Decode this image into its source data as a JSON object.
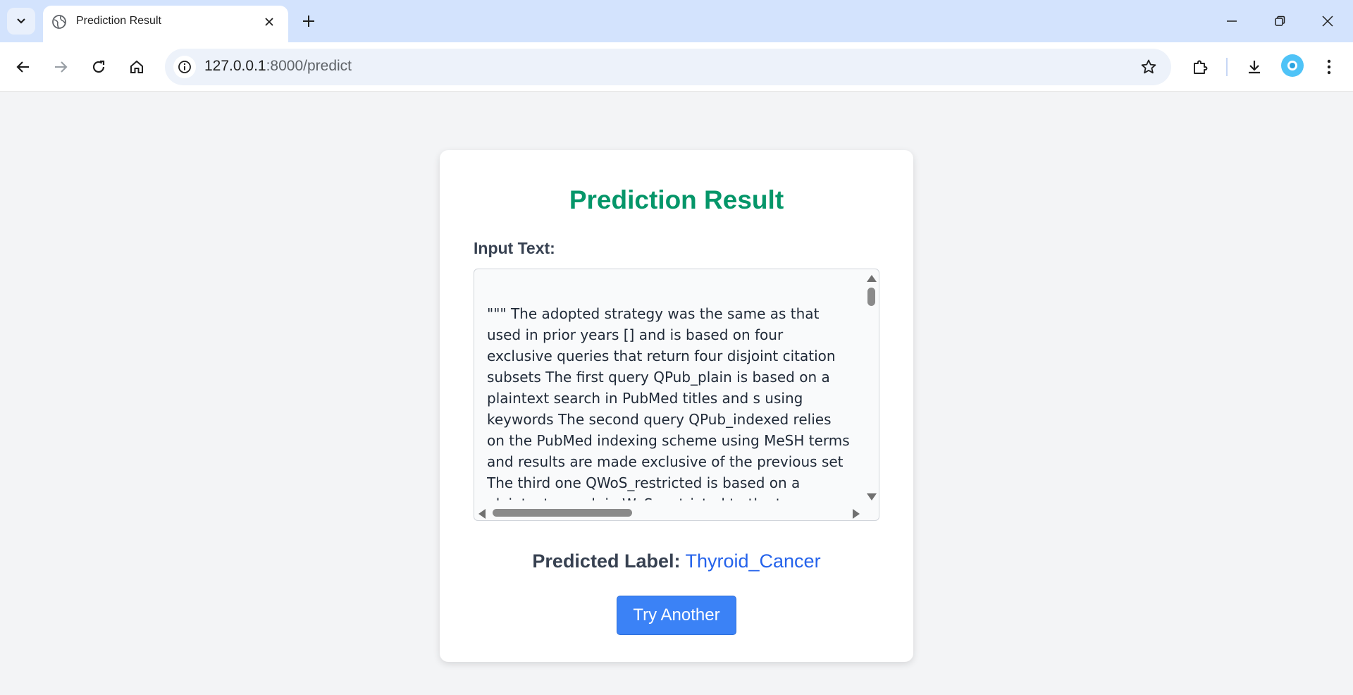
{
  "browser": {
    "tab": {
      "title": "Prediction Result"
    },
    "url": {
      "host": "127.0.0.1",
      "path": ":8000/predict"
    }
  },
  "page": {
    "heading": "Prediction Result",
    "input_label": "Input Text:",
    "input_text": "\"\"\" The adopted strategy was the same as that used in prior years [] and is based on four exclusive queries that return four disjoint citation subsets The first query QPub_plain is based on a plaintext search in PubMed titles and s using keywords The second query QPub_indexed relies on the PubMed indexing scheme using MeSH terms and results are made exclusive of the previous set The third one QWoS_restricted is based on a plaintext search in WoS restricted to the two research areas “Medical Informatics” and",
    "predicted_label_prefix": "Predicted Label:",
    "predicted_label_value": "Thyroid_Cancer",
    "try_another_label": "Try Another"
  },
  "colors": {
    "heading": "#059669",
    "predicted_value": "#2563eb",
    "button": "#3b82f6",
    "tabbar": "#d3e3fd"
  }
}
